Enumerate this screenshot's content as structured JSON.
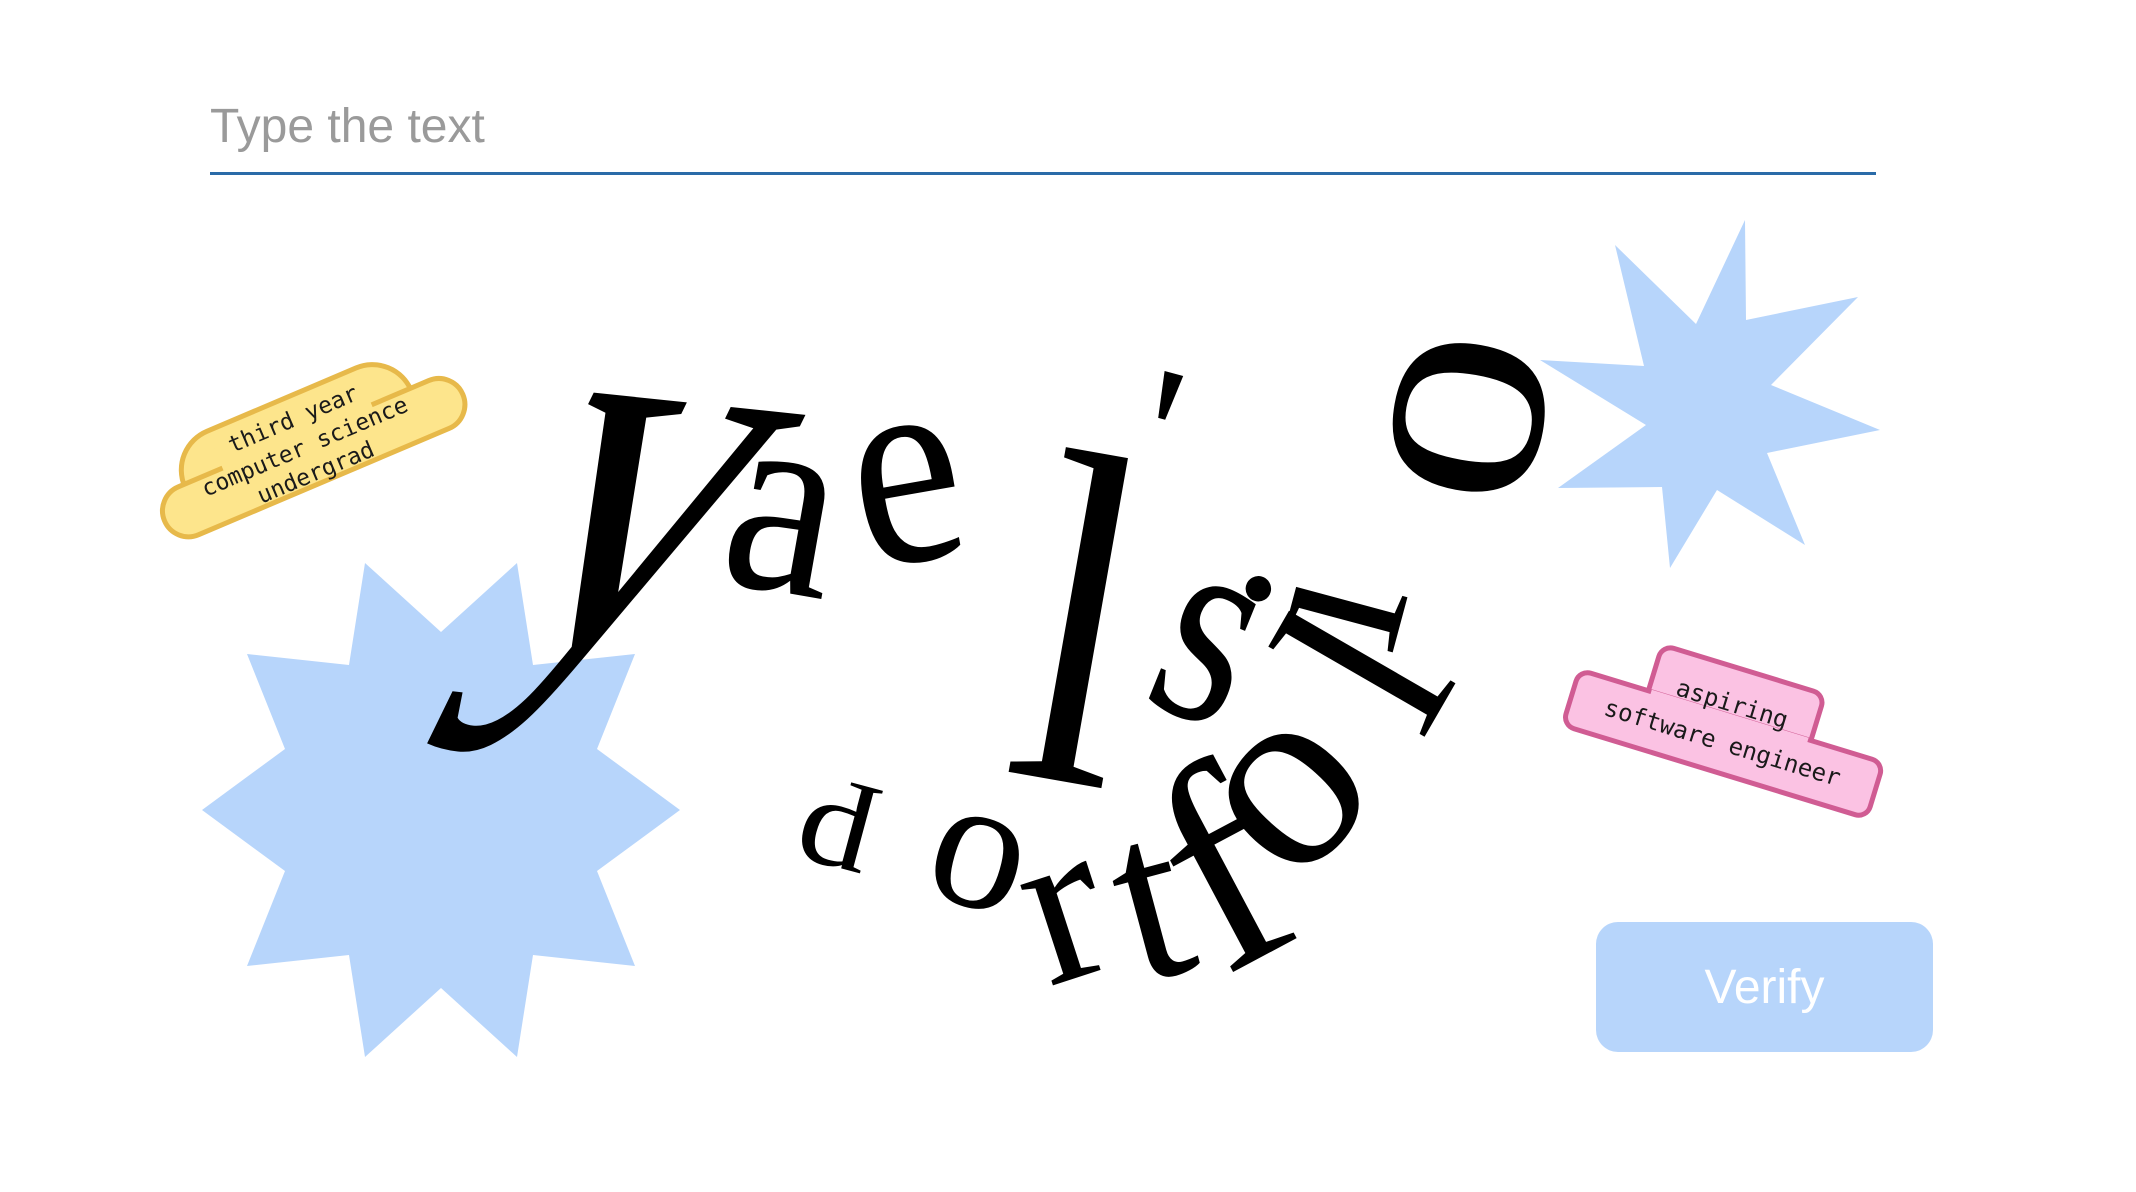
{
  "input": {
    "placeholder": "Type the text",
    "value": ""
  },
  "captcha": {
    "letters": [
      "y",
      "a",
      "e",
      "l",
      "'",
      "s",
      "p",
      "o",
      "r",
      "t",
      "f",
      "o",
      "l",
      "i",
      "o"
    ],
    "sticker_left": [
      "third year",
      "computer science",
      "undergrad"
    ],
    "sticker_right": [
      "aspiring",
      "software engineer"
    ]
  },
  "colors": {
    "star": "#b7d5fb",
    "sticker_yellow_fill": "#fde58c",
    "sticker_yellow_stroke": "#e7b94a",
    "sticker_pink_fill": "#fbc2e3",
    "sticker_pink_stroke": "#d05c93",
    "underline": "#2a6ba8",
    "button": "#b7d5fb"
  },
  "verify_button": {
    "label": "Verify"
  }
}
